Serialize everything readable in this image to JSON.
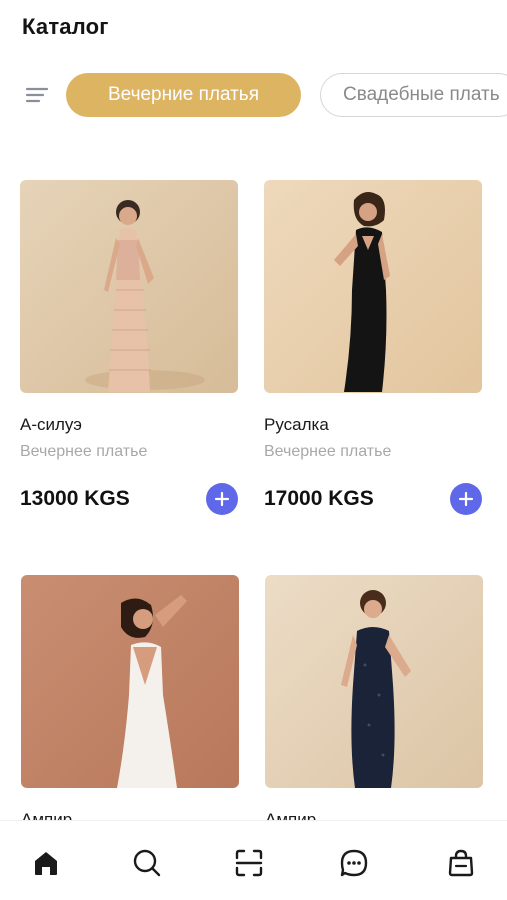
{
  "header": {
    "title": "Каталог"
  },
  "filters": {
    "menu_icon": "filter-lines-icon",
    "chips": [
      {
        "label": "Вечерние платья",
        "active": true
      },
      {
        "label": "Свадебные плать",
        "active": false
      }
    ]
  },
  "products": [
    {
      "name": "А-силуэ",
      "subtitle": "Вечернее платье",
      "price": "13000 KGS"
    },
    {
      "name": "Русалка",
      "subtitle": "Вечернее платье",
      "price": "17000 KGS"
    },
    {
      "name": "Ампир",
      "subtitle": "",
      "price": ""
    },
    {
      "name": "Ампир",
      "subtitle": "",
      "price": ""
    }
  ],
  "colors": {
    "accent": "#dcb462",
    "add_button": "#5f68e8",
    "muted_text": "#a8a8a8"
  },
  "bottom_nav": [
    {
      "icon": "home-icon",
      "active": true
    },
    {
      "icon": "search-icon",
      "active": false
    },
    {
      "icon": "scan-icon",
      "active": false
    },
    {
      "icon": "chat-icon",
      "active": false
    },
    {
      "icon": "shopping-bag-icon",
      "active": false
    }
  ]
}
